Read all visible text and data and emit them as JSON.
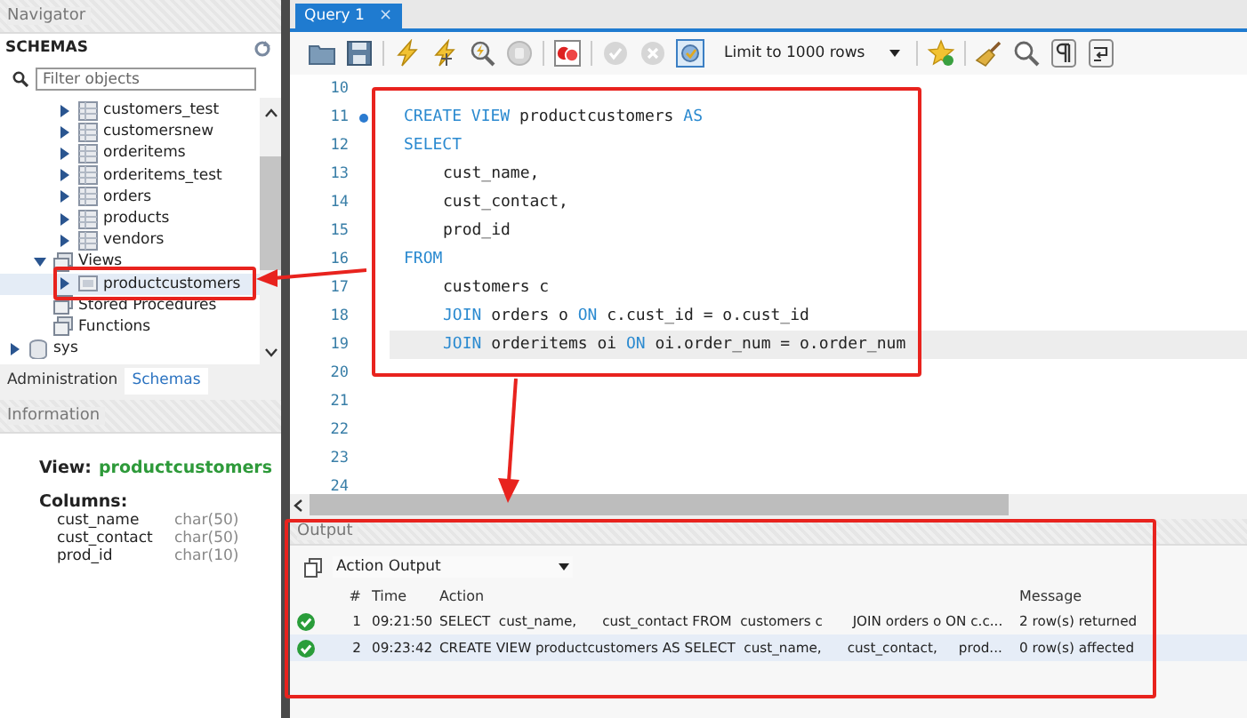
{
  "navigator": {
    "title": "Navigator",
    "schemas_label": "SCHEMAS",
    "filter": {
      "placeholder": "Filter objects"
    },
    "tree": [
      {
        "children": [
          {
            "children": [
              {
                "label": "customers_test",
                "kind": "table",
                "expanded": false,
                "selected": false
              },
              {
                "label": "customersnew",
                "kind": "table",
                "expanded": false,
                "selected": false
              },
              {
                "label": "orderitems",
                "kind": "table",
                "expanded": false,
                "selected": false
              },
              {
                "label": "orderitems_test",
                "kind": "table",
                "expanded": false,
                "selected": false
              },
              {
                "label": "orders",
                "kind": "table",
                "expanded": false,
                "selected": false
              },
              {
                "label": "products",
                "kind": "table",
                "expanded": false,
                "selected": false
              },
              {
                "label": "vendors",
                "kind": "table",
                "expanded": false,
                "selected": false
              }
            ]
          },
          {
            "label": "Views",
            "kind": "folder",
            "expanded": true,
            "selected": false,
            "children": [
              {
                "label": "productcustomers",
                "kind": "view",
                "expanded": false,
                "selected": true
              }
            ]
          },
          {
            "label": "Stored Procedures",
            "kind": "folder",
            "selected": false
          },
          {
            "label": "Functions",
            "kind": "folder",
            "selected": false
          }
        ]
      },
      {
        "label": "sys",
        "kind": "schema",
        "expanded": false,
        "selected": false
      }
    ],
    "tabs": [
      {
        "label": "Administration",
        "selected": false
      },
      {
        "label": "Schemas",
        "selected": true
      }
    ]
  },
  "information": {
    "title": "Information",
    "object_label": "View:",
    "object_name": "productcustomers",
    "columns_label": "Columns:",
    "columns": [
      {
        "name": "cust_name",
        "type": "char(50)"
      },
      {
        "name": "cust_contact",
        "type": "char(50)"
      },
      {
        "name": "prod_id",
        "type": "char(10)"
      }
    ]
  },
  "editor_tabs": [
    {
      "label": "Query 1",
      "selected": true,
      "close": "×"
    }
  ],
  "toolbar": {
    "limit": "Limit to 1000 rows"
  },
  "code_lines": [
    {
      "number": "10"
    },
    {
      "number": "11",
      "marker": true,
      "tokens": [
        {
          "text": "CREATE VIEW",
          "kind": "keyword"
        },
        {
          "text": " productcustomers ",
          "kind": "plain"
        },
        {
          "text": "AS",
          "kind": "keyword"
        }
      ]
    },
    {
      "number": "12",
      "tokens": [
        {
          "text": "SELECT",
          "kind": "keyword"
        }
      ]
    },
    {
      "number": "13",
      "indented": true,
      "tokens": [
        {
          "text": "cust_name,",
          "kind": "plain"
        }
      ]
    },
    {
      "number": "14",
      "indented": true,
      "tokens": [
        {
          "text": "cust_contact,",
          "kind": "plain"
        }
      ]
    },
    {
      "number": "15",
      "indented": true,
      "tokens": [
        {
          "text": "prod_id",
          "kind": "plain"
        }
      ]
    },
    {
      "number": "16",
      "tokens": [
        {
          "text": "FROM",
          "kind": "keyword"
        }
      ]
    },
    {
      "number": "17",
      "indented": true,
      "tokens": [
        {
          "text": "customers c",
          "kind": "plain"
        }
      ]
    },
    {
      "number": "18",
      "indented": true,
      "tokens": [
        {
          "text": "JOIN",
          "kind": "keyword"
        },
        {
          "text": " orders o ",
          "kind": "plain"
        },
        {
          "text": "ON",
          "kind": "keyword"
        },
        {
          "text": " c.cust_id = o.cust_id",
          "kind": "plain"
        }
      ]
    },
    {
      "number": "19",
      "indented": true,
      "current": true,
      "tokens": [
        {
          "text": "JOIN",
          "kind": "keyword"
        },
        {
          "text": " orderitems oi ",
          "kind": "plain"
        },
        {
          "text": "ON",
          "kind": "keyword"
        },
        {
          "text": " oi.order_num = o.order_num",
          "kind": "plain"
        }
      ]
    },
    {
      "number": "20"
    },
    {
      "number": "21"
    },
    {
      "number": "22"
    },
    {
      "number": "23"
    },
    {
      "number": "24"
    }
  ],
  "output": {
    "title": "Output",
    "selector": "Action Output",
    "columns": [
      "#",
      "Time",
      "Action",
      "Message"
    ],
    "rows": [
      {
        "succeeded": true,
        "number": "1",
        "time": "09:21:50",
        "action": "SELECT  cust_name,      cust_contact FROM  customers c       JOIN orders o ON c.c...",
        "message": "2 row(s) returned",
        "selected": false
      },
      {
        "succeeded": true,
        "number": "2",
        "time": "09:23:42",
        "action": "CREATE VIEW productcustomers AS SELECT  cust_name,      cust_contact,     prod...",
        "message": "0 row(s) affected",
        "selected": true
      }
    ]
  }
}
